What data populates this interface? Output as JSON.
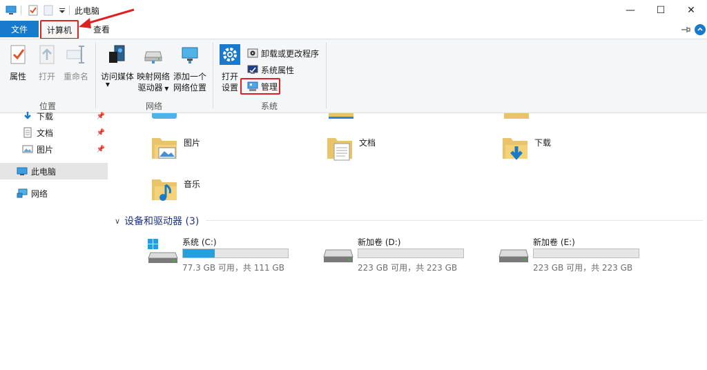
{
  "window": {
    "title": "此电脑",
    "minimize": "—",
    "maximize": "☐",
    "close": "✕"
  },
  "tabs": {
    "file": "文件",
    "computer": "计算机",
    "view": "查看"
  },
  "ribbon": {
    "location": {
      "label": "位置",
      "properties": "属性",
      "open": "打开",
      "rename": "重命名"
    },
    "network": {
      "label": "网络",
      "access_media": "访问媒体",
      "map_drive_1": "映射网络",
      "map_drive_2": "驱动器",
      "add_location_1": "添加一个",
      "add_location_2": "网络位置"
    },
    "system": {
      "label": "系统",
      "open_settings_1": "打开",
      "open_settings_2": "设置",
      "uninstall": "卸载或更改程序",
      "sys_props": "系统属性",
      "manage": "管理"
    }
  },
  "sidebar": {
    "items": [
      {
        "label": "下载"
      },
      {
        "label": "文档"
      },
      {
        "label": "图片"
      },
      {
        "label": "此电脑"
      },
      {
        "label": "网络"
      }
    ]
  },
  "folders": [
    {
      "name": "图片"
    },
    {
      "name": "文档"
    },
    {
      "name": "下载"
    },
    {
      "name": "音乐"
    }
  ],
  "devices": {
    "header": "设备和驱动器 (3)",
    "drives": [
      {
        "name": "系统 (C:)",
        "free_text": "77.3 GB 可用，共 111 GB",
        "used_fraction": 0.3
      },
      {
        "name": "新加卷 (D:)",
        "free_text": "223 GB 可用，共 223 GB",
        "used_fraction": 0.0
      },
      {
        "name": "新加卷 (E:)",
        "free_text": "223 GB 可用，共 223 GB",
        "used_fraction": 0.0
      }
    ]
  },
  "colors": {
    "accent": "#1979ca",
    "highlight": "#e02020",
    "selection": "#e5e5e5",
    "drive_fill": "#26a0da"
  }
}
